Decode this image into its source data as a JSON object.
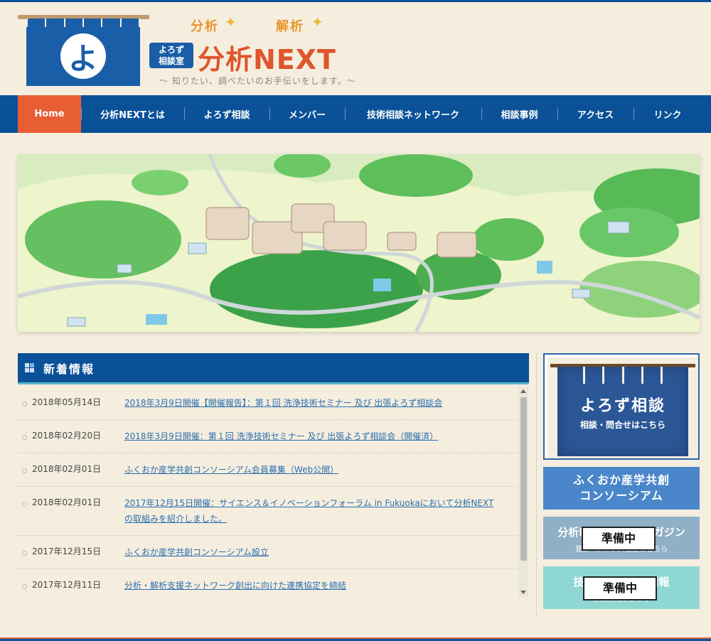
{
  "header": {
    "tagline_left": "分析",
    "tagline_right": "解析",
    "badge_line1": "よろず",
    "badge_line2": "相談室",
    "site_name": "分析NEXT",
    "subtitle": "〜 知りたい、調べたいのお手伝いをします。〜",
    "logo_char": "よ"
  },
  "nav": {
    "items": [
      {
        "label": "Home"
      },
      {
        "label": "分析NEXTとは"
      },
      {
        "label": "よろず相談"
      },
      {
        "label": "メンバー"
      },
      {
        "label": "技術相談ネットワーク"
      },
      {
        "label": "相談事例"
      },
      {
        "label": "アクセス"
      },
      {
        "label": "リンク"
      }
    ]
  },
  "news": {
    "title": "新着情報",
    "items": [
      {
        "date": "2018年05月14日",
        "text": "2018年3月9日開催【開催報告】：第１回 洗浄技術セミナー 及び 出張よろず相談会"
      },
      {
        "date": "2018年02月20日",
        "text": "2018年3月9日開催：第１回 洗浄技術セミナー 及び 出張よろず相談会（開催済）"
      },
      {
        "date": "2018年02月01日",
        "text": "ふくおか産学共創コンソーシアム会員募集（Web公開）"
      },
      {
        "date": "2018年02月01日",
        "text": "2017年12月15日開催：サイエンス＆イノベーションフォーラム in Fukuokaにおいて分析NEXTの取組みを紹介しました。"
      },
      {
        "date": "2017年12月15日",
        "text": "ふくおか産学共創コンソーシアム設立"
      },
      {
        "date": "2017年12月11日",
        "text": "分析・解析支援ネットワーク創出に向けた連携協定を締結"
      }
    ]
  },
  "sidebar": {
    "yorozu_title": "よろず相談",
    "yorozu_sub": "相談・問合せはこちら",
    "consortium_line1": "ふくおか産学共創",
    "consortium_line2": "コンソーシアム",
    "mag_title": "分析NEXTメールマガジン",
    "mag_sub": "登録・アドレス変更はこちら",
    "mag_status": "準備中",
    "tech_title": "技術相談・公募情報",
    "tech_sub": "募集情報はこちら",
    "tech_status": "準備中"
  },
  "colors": {
    "nav_bg": "#0a5197",
    "nav_active": "#e85e34",
    "accent": "#e0552c",
    "page_bg": "#f5eedf"
  }
}
